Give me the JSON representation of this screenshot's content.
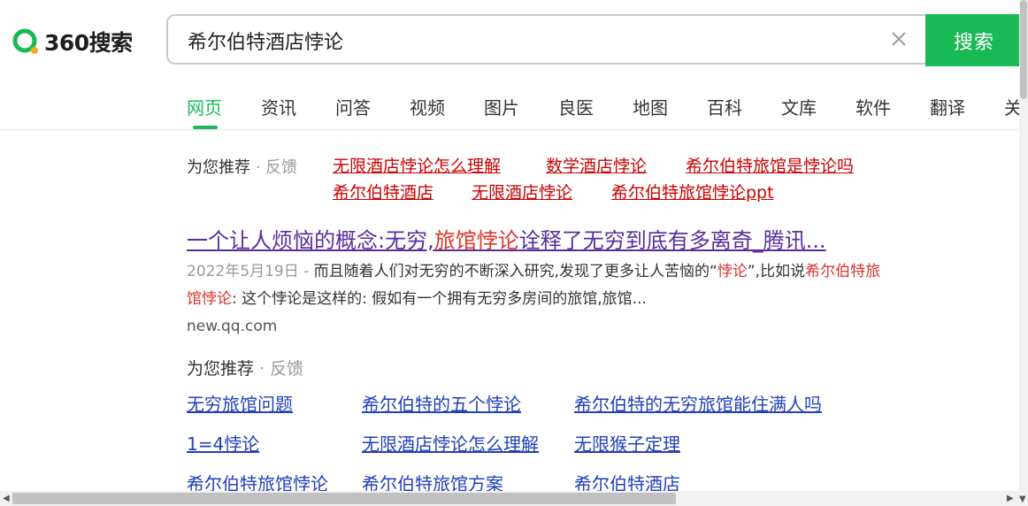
{
  "header": {
    "logo_text": "360搜索",
    "query": "希尔伯特酒店悖论",
    "search_button": "搜索"
  },
  "tabs": [
    "网页",
    "资讯",
    "问答",
    "视频",
    "图片",
    "良医",
    "地图",
    "百科",
    "文库",
    "软件",
    "翻译",
    "关"
  ],
  "recommend1": {
    "label": "为您推荐",
    "feedback": "· 反馈",
    "links": [
      "无限酒店悖论怎么理解",
      "数学酒店悖论",
      "希尔伯特旅馆是悖论吗",
      "希尔伯特酒店",
      "无限酒店悖论",
      "希尔伯特旅馆悖论ppt"
    ]
  },
  "result": {
    "title_a": "一个让人烦恼的概念:无穷,",
    "title_hl": "旅馆悖论",
    "title_b": "诠释了无穷到底有多离奇_腾讯...",
    "date": "2022年5月19日 - ",
    "desc_a": "而且随着人们对无穷的不断深入研究,发现了更多让人苦恼的“",
    "desc_hl1": "悖论",
    "desc_b": "”,比如说",
    "desc_hl2": "希尔伯特旅馆悖论",
    "desc_c": ": 这个悖论是这样的: 假如有一个拥有无穷多房间的旅馆,旅馆...",
    "url": "new.qq.com"
  },
  "recommend2": {
    "label": "为您推荐",
    "feedback": "· 反馈",
    "links": [
      "无穷旅馆问题",
      "希尔伯特的五个悖论",
      "希尔伯特的无穷旅馆能住满人吗",
      "1=4悖论",
      "无限酒店悖论怎么理解",
      "无限猴子定理",
      "希尔伯特旅馆悖论",
      "希尔伯特旅馆方案",
      "希尔伯特酒店"
    ]
  },
  "colors": {
    "brand_green": "#19b955",
    "link_red": "#cc0000",
    "link_blue": "#2241b8",
    "visited_purple": "#5a2d9b"
  }
}
